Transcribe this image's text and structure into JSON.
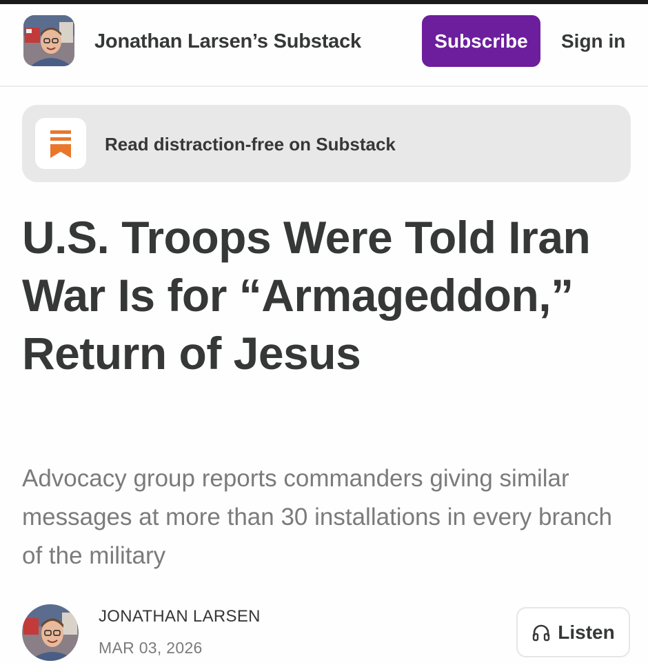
{
  "header": {
    "publication_name": "Jonathan Larsen’s Substack",
    "subscribe_label": "Subscribe",
    "signin_label": "Sign in"
  },
  "banner": {
    "text": "Read distraction-free on Substack",
    "icon": "substack-logo-icon"
  },
  "article": {
    "title": "U.S. Troops Were Told Iran War Is for “Armageddon,” Return of Jesus",
    "subtitle": "Advocacy group reports commanders giving similar messages at more than 30 installations in every branch of the military"
  },
  "byline": {
    "author": "JONATHAN LARSEN",
    "date": "MAR 03, 2026",
    "listen_label": "Listen",
    "listen_icon": "headphones-icon"
  },
  "colors": {
    "accent": "#6d1e9c",
    "substack_orange": "#e8772c",
    "text": "#363737",
    "muted": "#7b7b7b",
    "banner_bg": "#e8e8e8"
  }
}
